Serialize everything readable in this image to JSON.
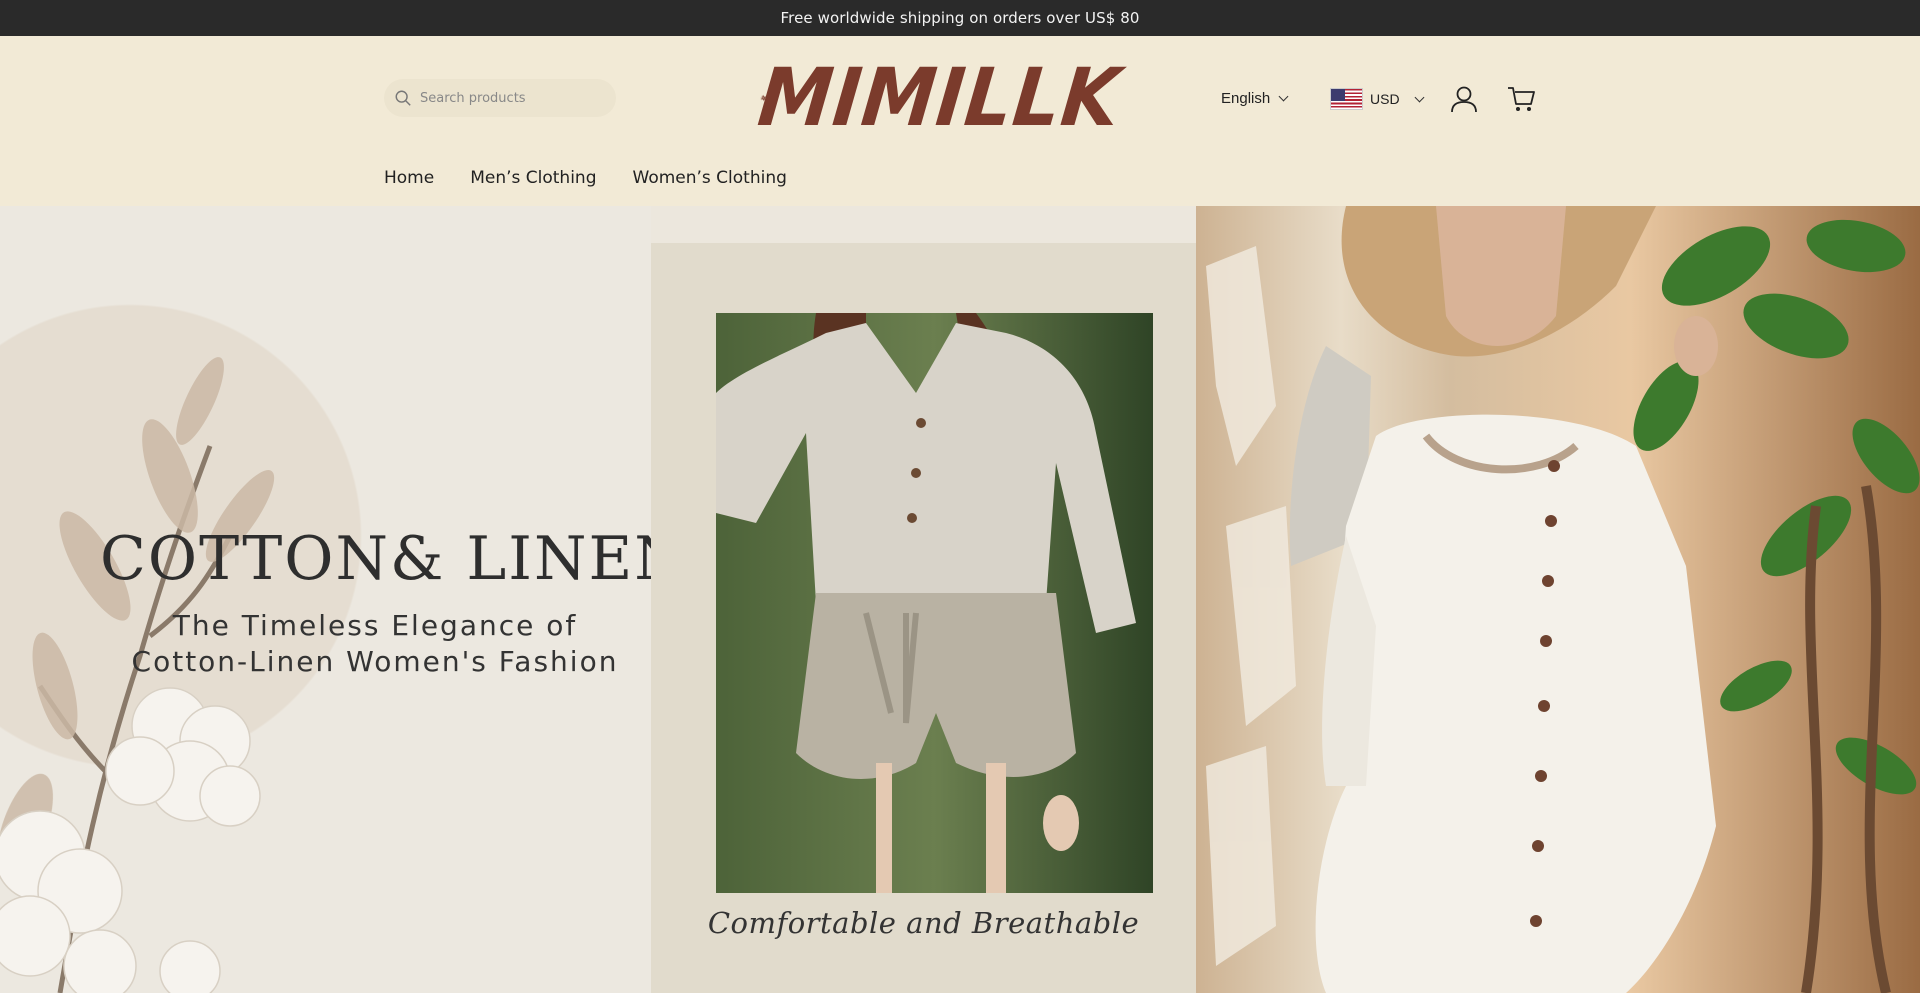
{
  "announcement": "Free worldwide shipping on orders over US$ 80",
  "search": {
    "placeholder": "Search products"
  },
  "logo": {
    "text": "MIMILLK"
  },
  "language": {
    "selected": "English"
  },
  "currency": {
    "selected": "USD"
  },
  "nav": {
    "items": [
      "Home",
      "Men’s Clothing",
      "Women’s Clothing"
    ]
  },
  "hero": {
    "headline": "COTTON& LINEN",
    "subline_1": "The Timeless Elegance of",
    "subline_2": "Cotton-Linen Women's Fashion",
    "caption": "Comfortable and Breathable"
  },
  "colors": {
    "announcement_bg": "#2a2a2a",
    "header_bg": "#f2ead6",
    "logo": "#7b3b2c"
  },
  "icons": [
    "search-icon",
    "account-icon",
    "cart-icon",
    "chevron-down-icon",
    "us-flag-icon",
    "sun-logo-icon"
  ]
}
